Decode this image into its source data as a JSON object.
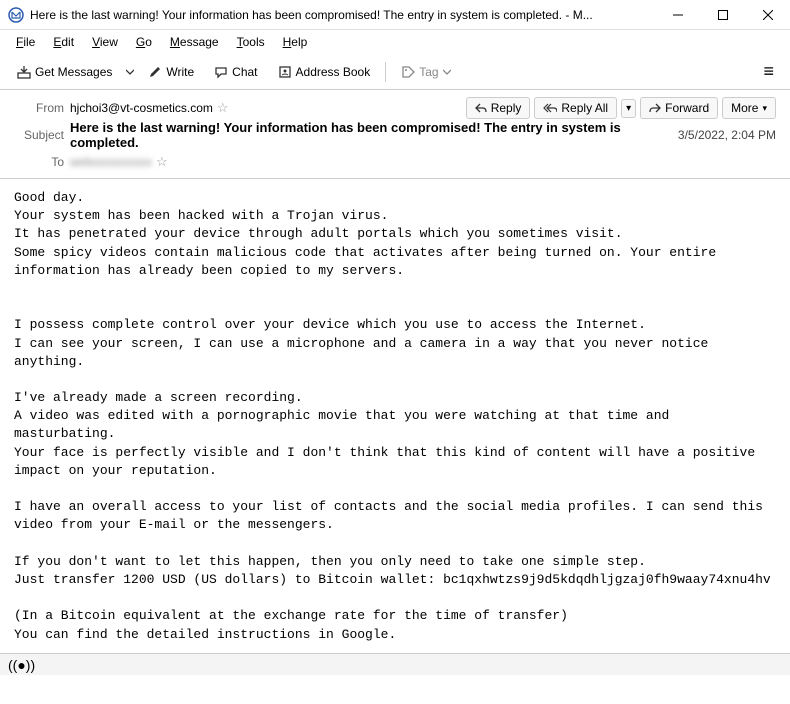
{
  "window": {
    "title": "Here is the last warning! Your information has been compromised! The entry in system is completed. - M..."
  },
  "menu": {
    "file": "File",
    "edit": "Edit",
    "view": "View",
    "go": "Go",
    "message": "Message",
    "tools": "Tools",
    "help": "Help"
  },
  "toolbar": {
    "get_messages": "Get Messages",
    "write": "Write",
    "chat": "Chat",
    "address_book": "Address Book",
    "tag": "Tag"
  },
  "headers": {
    "from_label": "From",
    "from_value": "hjchoi3@vt-cosmetics.com",
    "subject_label": "Subject",
    "subject_value": "Here is the last warning! Your information has been compromised! The entry in system is completed.",
    "to_label": "To",
    "to_value": "webxxxxxxxxxx",
    "date": "3/5/2022, 2:04 PM"
  },
  "actions": {
    "reply": "Reply",
    "reply_all": "Reply All",
    "forward": "Forward",
    "more": "More"
  },
  "body": "Good day.\nYour system has been hacked with a Trojan virus.\nIt has penetrated your device through adult portals which you sometimes visit.\nSome spicy videos contain malicious code that activates after being turned on. Your entire information has already been copied to my servers.\n\n\nI possess complete control over your device which you use to access the Internet.\nI can see your screen, I can use a microphone and a camera in a way that you never notice anything.\n\nI've already made a screen recording.\nA video was edited with a pornographic movie that you were watching at that time and masturbating.\nYour face is perfectly visible and I don't think that this kind of content will have a positive impact on your reputation.\n\nI have an overall access to your list of contacts and the social media profiles. I can send this video from your E-mail or the messengers.\n\nIf you don't want to let this happen, then you only need to take one simple step.\nJust transfer 1200 USD (US dollars) to Bitcoin wallet: bc1qxhwtzs9j9d5kdqdhljgzaj0fh9waay74xnu4hv\n\n(In a Bitcoin equivalent at the exchange rate for the time of transfer)\nYou can find the detailed instructions in Google."
}
